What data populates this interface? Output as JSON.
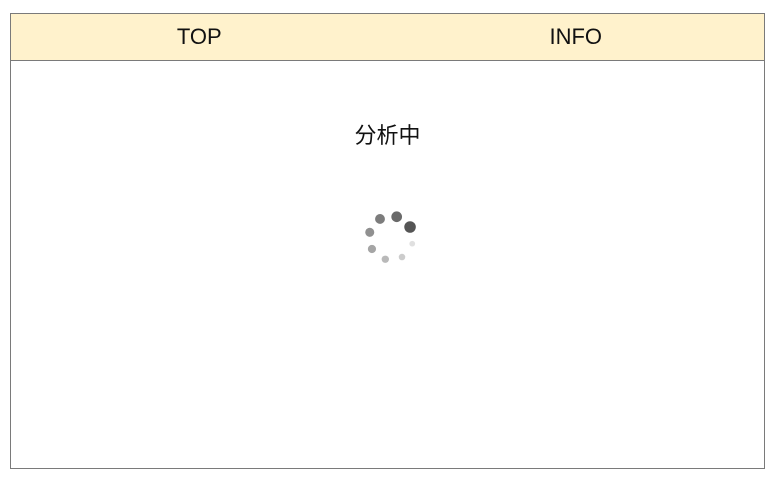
{
  "tabs": [
    {
      "label": "TOP"
    },
    {
      "label": "INFO"
    }
  ],
  "main": {
    "status_text": "分析中"
  },
  "colors": {
    "tabbar_bg": "#fff2cc",
    "border": "#7a7a7a",
    "spinner": "#555555"
  },
  "spinner": {
    "icon": "loading-spinner-icon",
    "dot_count": 8
  }
}
